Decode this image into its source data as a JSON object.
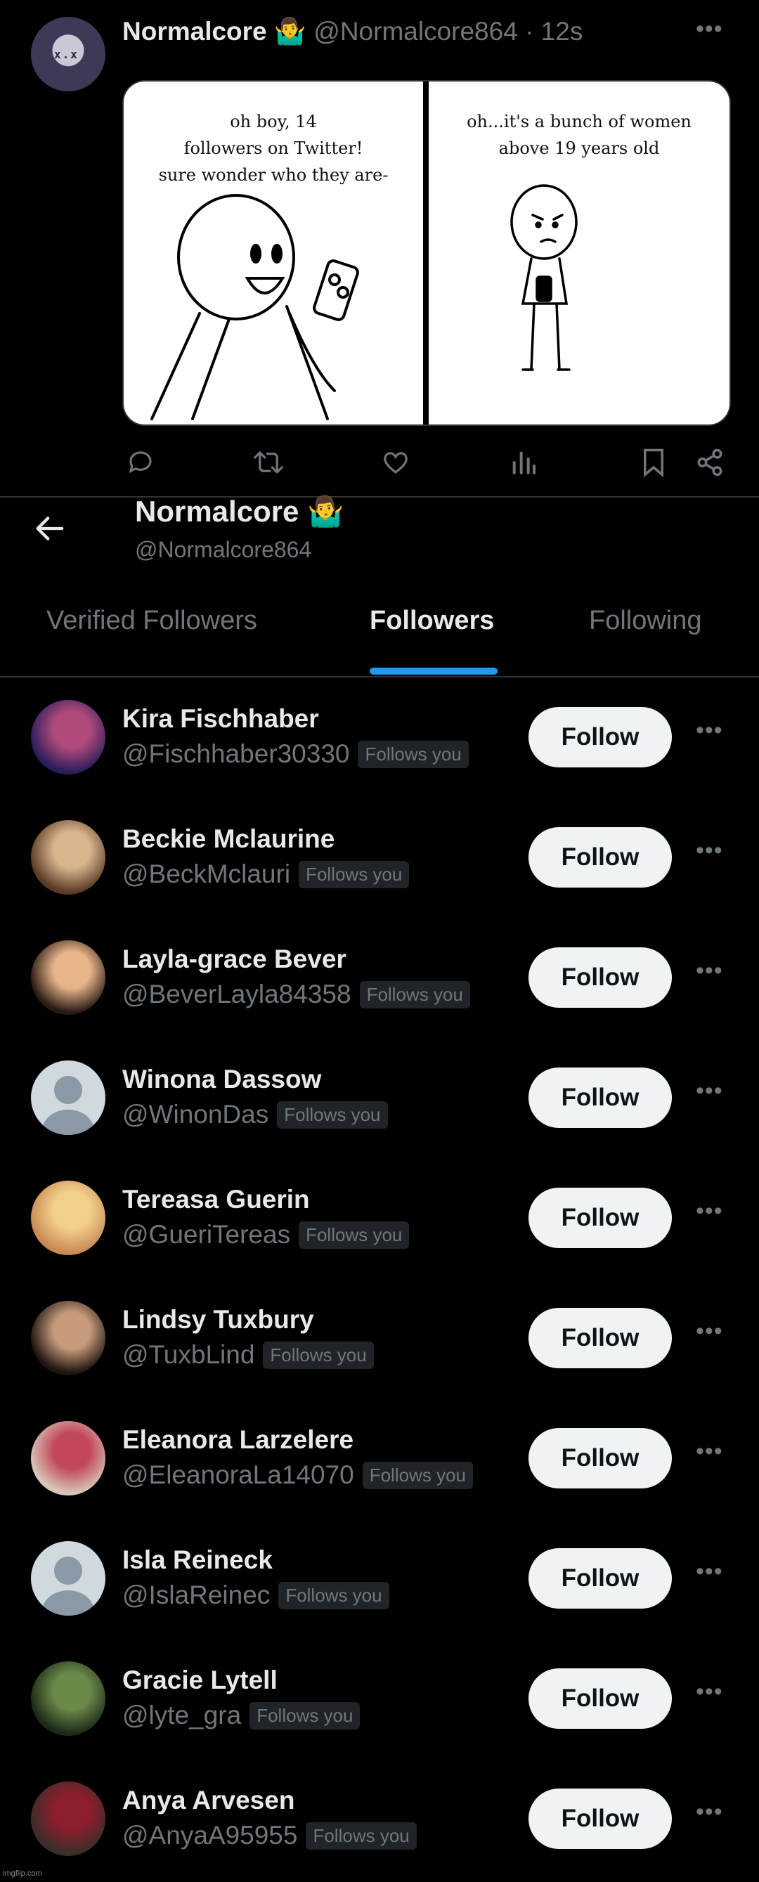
{
  "tweet": {
    "author_name": "Normalcore 🤷‍♂️",
    "author_handle": "@Normalcore864",
    "separator": "·",
    "time": "12s",
    "comic": {
      "panel1_caption": "oh boy, 14\nfollowers on Twitter!\nsure wonder who they are-",
      "panel2_caption": "oh...it's a bunch of women\nabove 19 years old"
    },
    "action_icons": [
      "reply-icon",
      "retweet-icon",
      "like-icon",
      "views-icon",
      "bookmark-icon",
      "share-icon"
    ]
  },
  "profile": {
    "name": "Normalcore 🤷‍♂️",
    "handle": "@Normalcore864"
  },
  "tabs": [
    {
      "label": "Verified Followers",
      "active": false
    },
    {
      "label": "Followers",
      "active": true
    },
    {
      "label": "Following",
      "active": false
    }
  ],
  "accent_color": "#1d9bf0",
  "followers": [
    {
      "name": "Kira Fischhaber",
      "handle": "@Fischhaber30330",
      "badge": "Follows you",
      "button": "Follow",
      "avatar": "photo",
      "c1": "#2b1d5c",
      "c2": "#b04a7a"
    },
    {
      "name": "Beckie Mclaurine",
      "handle": "@BeckMclauri",
      "badge": "Follows you",
      "button": "Follow",
      "avatar": "photo",
      "c1": "#5a3b25",
      "c2": "#d9b58e"
    },
    {
      "name": "Layla-grace Bever",
      "handle": "@BeverLayla84358",
      "badge": "Follows you",
      "button": "Follow",
      "avatar": "photo",
      "c1": "#2a1a14",
      "c2": "#e8b48a"
    },
    {
      "name": "Winona Dassow",
      "handle": "@WinonDas",
      "badge": "Follows you",
      "button": "Follow",
      "avatar": "default"
    },
    {
      "name": "Tereasa Guerin",
      "handle": "@GueriTereas",
      "badge": "Follows you",
      "button": "Follow",
      "avatar": "photo",
      "c1": "#c98a52",
      "c2": "#f2d08c"
    },
    {
      "name": "Lindsy Tuxbury",
      "handle": "@TuxbLind",
      "badge": "Follows you",
      "button": "Follow",
      "avatar": "photo",
      "c1": "#1e1410",
      "c2": "#c79b7a"
    },
    {
      "name": "Eleanora Larzelere",
      "handle": "@EleanoraLa14070",
      "badge": "Follows you",
      "button": "Follow",
      "avatar": "photo",
      "c1": "#d7c7b8",
      "c2": "#c2475a"
    },
    {
      "name": "Isla Reineck",
      "handle": "@IslaReinec",
      "badge": "Follows you",
      "button": "Follow",
      "avatar": "default"
    },
    {
      "name": "Gracie Lytell",
      "handle": "@lyte_gra",
      "badge": "Follows you",
      "button": "Follow",
      "avatar": "photo",
      "c1": "#1c2a18",
      "c2": "#6b8a4a"
    },
    {
      "name": "Anya Arvesen",
      "handle": "@AnyaA95955",
      "badge": "Follows you",
      "button": "Follow",
      "avatar": "photo",
      "c1": "#3a2e28",
      "c2": "#8c1e2e"
    }
  ],
  "watermark": "imgflip.com"
}
